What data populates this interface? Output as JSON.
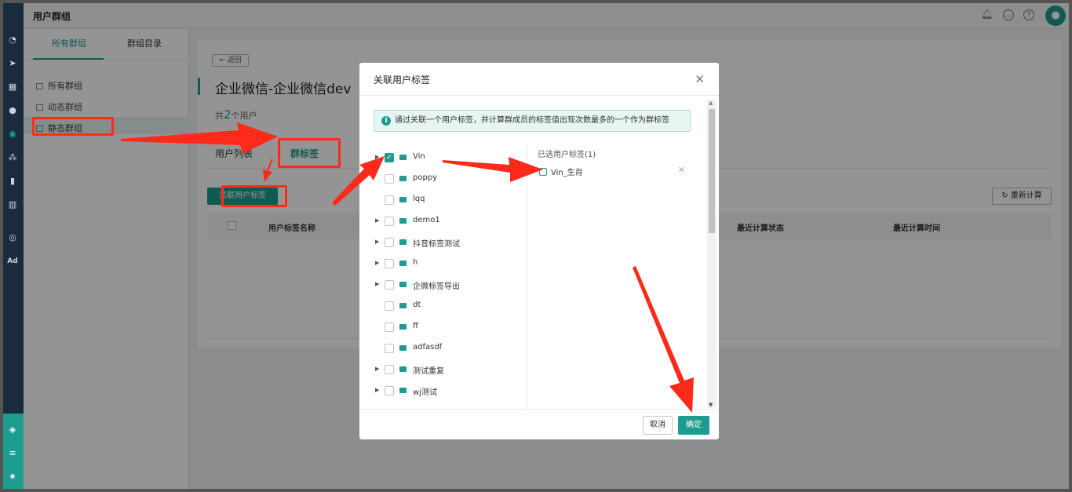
{
  "header": {
    "title": "用户群组"
  },
  "leftnav": {
    "tabs": [
      "所有群组",
      "群组目录"
    ],
    "items": [
      "所有群组",
      "动态群组",
      "静态群组"
    ]
  },
  "main": {
    "back": "← 返回",
    "title": "企业微信-企业微信dev",
    "count_prefix": "共",
    "count_value": "2",
    "count_suffix": "个用户",
    "subtabs": [
      "用户列表",
      "群标签"
    ],
    "action_button": "关联用户标签",
    "recalc_button": "重新计算",
    "table_headers": [
      "用户标签名称",
      "最近计算状态",
      "最近计算时间"
    ]
  },
  "modal": {
    "title": "关联用户标签",
    "notice": "通过关联一个用户标签，并计算群成员的标签值出现次数最多的一个作为群标签",
    "tree": [
      {
        "label": "Vin",
        "checked": true,
        "expandable": true
      },
      {
        "label": "poppy",
        "checked": false,
        "expandable": false
      },
      {
        "label": "lqq",
        "checked": false,
        "expandable": false
      },
      {
        "label": "demo1",
        "checked": false,
        "expandable": true
      },
      {
        "label": "抖音标签测试",
        "checked": false,
        "expandable": true
      },
      {
        "label": "h",
        "checked": false,
        "expandable": true
      },
      {
        "label": "企微标签导出",
        "checked": false,
        "expandable": true
      },
      {
        "label": "dt",
        "checked": false,
        "expandable": false
      },
      {
        "label": "ff",
        "checked": false,
        "expandable": false
      },
      {
        "label": "adfasdf",
        "checked": false,
        "expandable": false
      },
      {
        "label": "测试重复",
        "checked": false,
        "expandable": true
      },
      {
        "label": "wj测试",
        "checked": false,
        "expandable": true
      }
    ],
    "selected_header": "已选用户标签(1)",
    "selected_items": [
      "Vin_生肖"
    ],
    "cancel": "取消",
    "confirm": "确定"
  },
  "colors": {
    "accent": "#1e9c8f",
    "annotation": "#ff2a1a",
    "rail": "#1a2b3d"
  },
  "icons": [
    "bell-icon",
    "chat-icon",
    "help-icon",
    "user-avatar-icon",
    "info-icon",
    "folder-icon",
    "tag-icon",
    "close-icon",
    "refresh-icon"
  ]
}
